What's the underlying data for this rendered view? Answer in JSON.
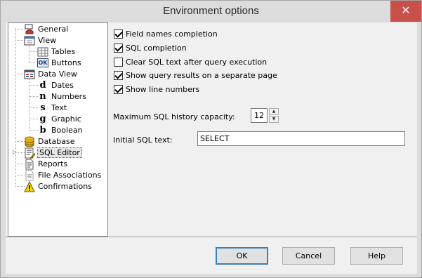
{
  "window": {
    "title": "Environment options",
    "close_label": "✕"
  },
  "tree": {
    "items": [
      {
        "label": "General",
        "icon": "general-icon"
      },
      {
        "label": "View",
        "icon": "view-icon"
      },
      {
        "label": "Tables",
        "icon": "tables-icon"
      },
      {
        "label": "Buttons",
        "icon": "buttons-icon",
        "icon_text": "OK"
      },
      {
        "label": "Data View",
        "icon": "data-view-icon"
      },
      {
        "label": "Dates",
        "icon": "dates-icon",
        "icon_text": "d"
      },
      {
        "label": "Numbers",
        "icon": "numbers-icon",
        "icon_text": "n"
      },
      {
        "label": "Text",
        "icon": "text-icon",
        "icon_text": "s"
      },
      {
        "label": "Graphic",
        "icon": "graphic-icon",
        "icon_text": "g"
      },
      {
        "label": "Boolean",
        "icon": "boolean-icon",
        "icon_text": "b"
      },
      {
        "label": "Database",
        "icon": "database-icon"
      },
      {
        "label": "SQL Editor",
        "icon": "sql-editor-icon",
        "selected": true
      },
      {
        "label": "Reports",
        "icon": "reports-icon"
      },
      {
        "label": "File Associations",
        "icon": "file-associations-icon"
      },
      {
        "label": "Confirmations",
        "icon": "confirmations-icon"
      }
    ]
  },
  "options": {
    "field_names_completion": {
      "label": "Field names completion",
      "checked": true
    },
    "sql_completion": {
      "label": "SQL completion",
      "checked": true
    },
    "clear_sql_text": {
      "label": "Clear SQL text after query execution",
      "checked": false
    },
    "show_query_results": {
      "label": "Show query results on a separate page",
      "checked": true
    },
    "show_line_numbers": {
      "label": "Show line numbers",
      "checked": true
    }
  },
  "history": {
    "label": "Maximum SQL history capacity:",
    "value": "12"
  },
  "initial_sql": {
    "label": "Initial SQL text:",
    "value": "SELECT"
  },
  "buttons": {
    "ok": "OK",
    "cancel": "Cancel",
    "help": "Help"
  }
}
